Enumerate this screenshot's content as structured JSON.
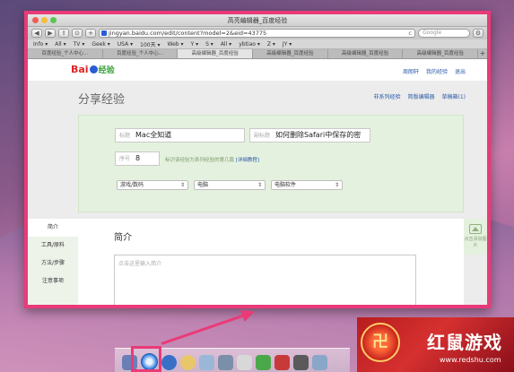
{
  "window": {
    "title": "高亮编辑器_百度经验"
  },
  "toolbar": {
    "back_label": "◀",
    "forward_label": "▶",
    "share_label": "⇪",
    "reader_label": "⊙",
    "add_label": "+",
    "url": "jingyan.baidu.com/edit/content?model=2&eid=43775",
    "reload_label": "c",
    "search_placeholder": "Google",
    "settings_label": "⚙"
  },
  "bookmarks": [
    "Info ▾",
    "All ▾",
    "TV ▾",
    "Geek ▾",
    "USA ▾",
    "100天 ▾",
    "Web ▾",
    "Y ▾",
    "S ▾",
    "All ▾",
    "ybtiao ▾",
    "Z ▾",
    "JY ▾"
  ],
  "tabs": [
    {
      "label": "百度经验_个人中心..."
    },
    {
      "label": "百度经验_个人中心..."
    },
    {
      "label": "高级编辑器_百度经验"
    },
    {
      "label": "高级编辑器_百度经验"
    },
    {
      "label": "高级编辑器_百度经验"
    },
    {
      "label": "高级编辑器_百度经验"
    }
  ],
  "tab_plus": "+",
  "page": {
    "logo_main": "Bai",
    "logo_suffix": "经验",
    "top_links": [
      "周朗轩",
      "我的经验",
      "退出"
    ],
    "heading": "分享经验",
    "head_links": [
      "非系列经验",
      "简版编辑器",
      "草稿箱(1)"
    ],
    "form": {
      "title_label": "标题",
      "title_value": "Mac全知道",
      "subtitle_label": "副标题",
      "subtitle_value": "如何删除Safari中保存的密",
      "serial_label": "序号",
      "serial_value": "8",
      "serial_tip": "标识该经验为系列经验的第几篇",
      "serial_tip_link": "[详细教程]",
      "selects": [
        "游戏/数码",
        "电脑",
        "电脑软件"
      ]
    },
    "side_nav": [
      "简介",
      "工具/原料",
      "方法/步骤",
      "注意事项"
    ],
    "intro_heading": "简介",
    "intro_placeholder": "点击这里输入简介",
    "right_panel_label": "点击添加图片"
  },
  "watermark": {
    "circle_text": "卍",
    "brand": "红鼠游戏",
    "url": "www.redshu.com"
  },
  "colors": {
    "highlight": "#ea3a78",
    "form_panel": "#e5f1df",
    "link": "#2b5aa8"
  }
}
